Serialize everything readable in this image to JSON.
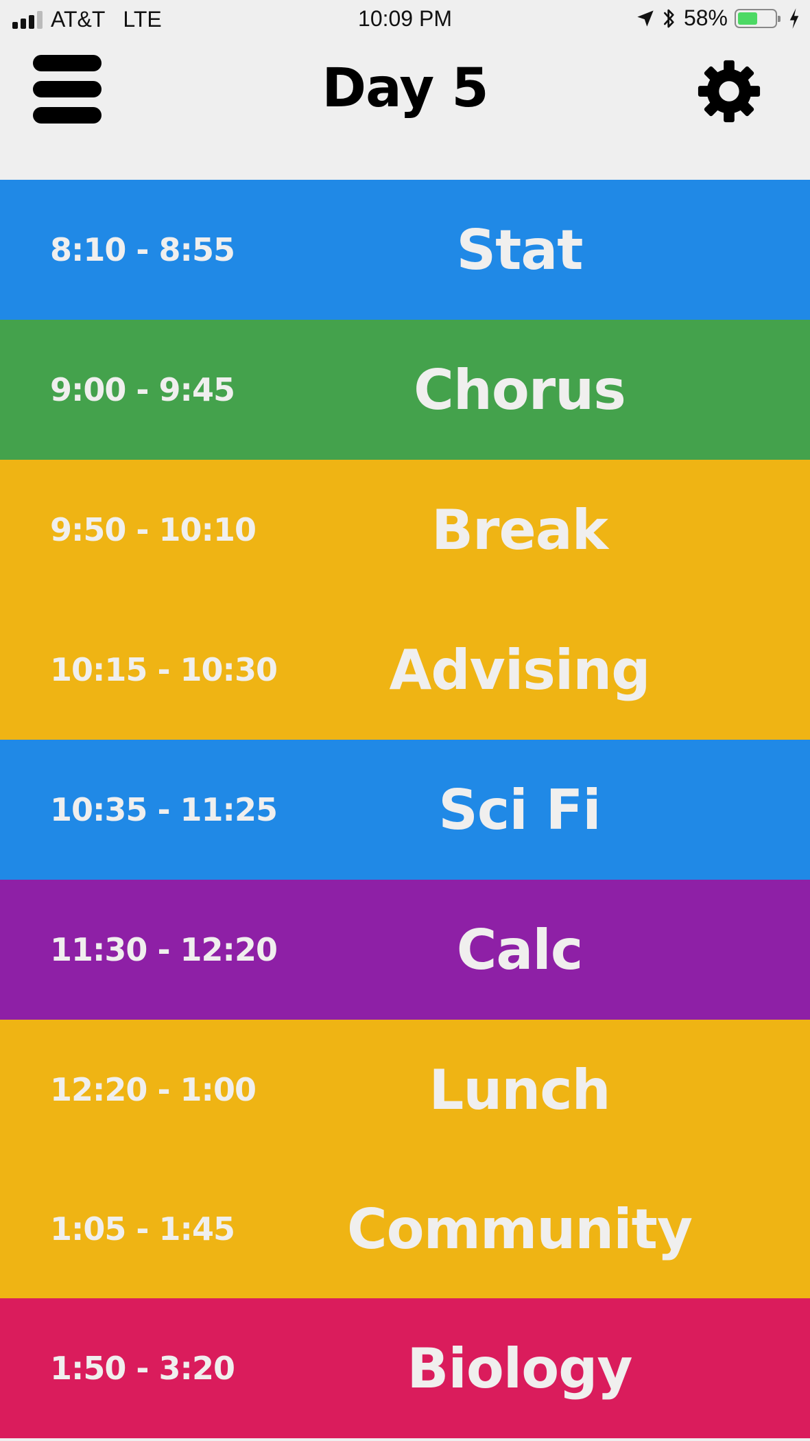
{
  "status_bar": {
    "carrier": "AT&T",
    "network": "LTE",
    "time": "10:09 PM",
    "battery_percent": "58%",
    "battery_level": 0.58,
    "icons": [
      "signal-icon",
      "location-arrow-icon",
      "bluetooth-icon",
      "battery-icon",
      "charging-bolt-icon"
    ]
  },
  "header": {
    "title": "Day 5",
    "menu_icon": "hamburger-menu-icon",
    "settings_icon": "gear-icon"
  },
  "colors": {
    "blue": "#2089e6",
    "green": "#44a24c",
    "yellow": "#efb414",
    "purple": "#8e20a6",
    "red": "#da1c5c",
    "text": "#f0efee"
  },
  "periods": [
    {
      "time": "8:10 - 8:55",
      "name": "Stat",
      "color": "#2089e6"
    },
    {
      "time": "9:00 - 9:45",
      "name": "Chorus",
      "color": "#44a24c"
    },
    {
      "time": "9:50 - 10:10",
      "name": "Break",
      "color": "#efb414"
    },
    {
      "time": "10:15 - 10:30",
      "name": "Advising",
      "color": "#efb414"
    },
    {
      "time": "10:35 - 11:25",
      "name": "Sci Fi",
      "color": "#2089e6"
    },
    {
      "time": "11:30 - 12:20",
      "name": "Calc",
      "color": "#8e20a6"
    },
    {
      "time": "12:20 - 1:00",
      "name": "Lunch",
      "color": "#efb414"
    },
    {
      "time": "1:05 - 1:45",
      "name": "Community",
      "color": "#efb414"
    },
    {
      "time": "1:50 - 3:20",
      "name": "Biology",
      "color": "#da1c5c"
    }
  ]
}
